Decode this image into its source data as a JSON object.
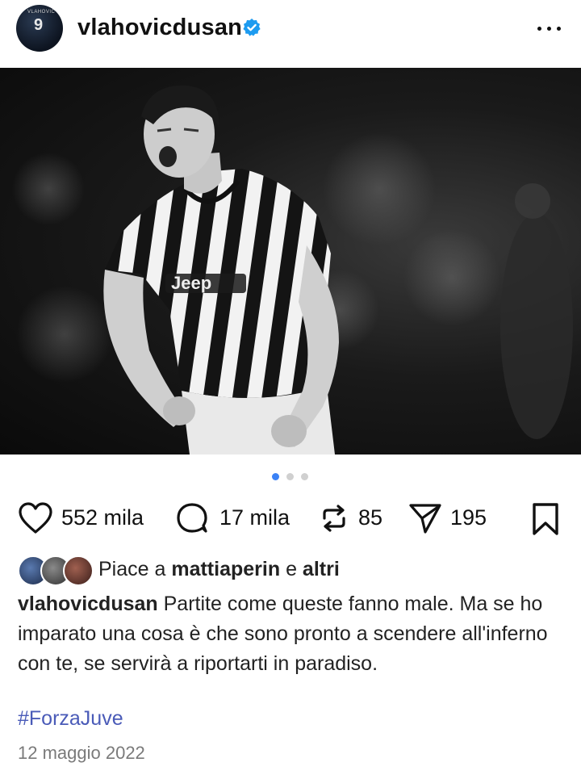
{
  "header": {
    "avatar_number": "9",
    "avatar_label": "VLAHOVIC",
    "username": "vlahovicdusan",
    "verified_icon": "verified-badge-icon",
    "more_icon": "more-options-icon"
  },
  "post": {
    "image_icon": "photo",
    "carousel": {
      "total": 3,
      "active": 1
    }
  },
  "actions": {
    "like_count": "552 mila",
    "comment_count": "17 mila",
    "repost_count": "85",
    "share_count": "195",
    "like_icon": "heart-icon",
    "comment_icon": "comment-bubble-icon",
    "repost_icon": "repost-icon",
    "share_icon": "share-plane-icon",
    "save_icon": "bookmark-icon"
  },
  "likes": {
    "prefix": "Piace a",
    "user": "mattiaperin",
    "connector": "e",
    "others": "altri"
  },
  "caption": {
    "username": "vlahovicdusan",
    "text": "Partite come queste fanno male. Ma se ho imparato una cosa è che sono pronto a scendere all'inferno con te, se servirà a riportarti in paradiso.",
    "hashtag": "#ForzaJuve"
  },
  "date": "12 maggio 2022",
  "colors": {
    "accent_blue": "#3b82f6",
    "verified_blue": "#1d9bf0",
    "hashtag": "#4a5bb8",
    "muted": "#7a7a7a"
  }
}
